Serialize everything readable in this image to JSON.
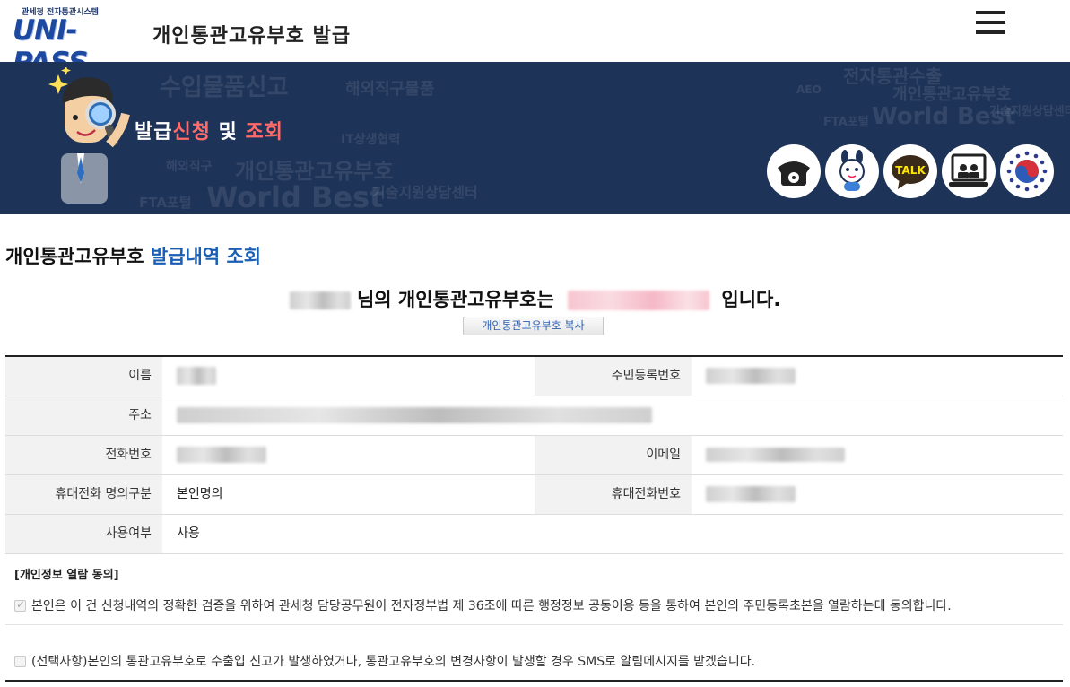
{
  "header": {
    "logo_sub": "관세청 전자통관시스템",
    "logo_main": "UNI-PASS",
    "title": "개인통관고유부호 발급"
  },
  "banner": {
    "title_part1": "발급",
    "title_part2": "신청",
    "title_part3": " 및 ",
    "title_part4": "조회",
    "background_words": [
      "수입물품신고",
      "해외직구물품",
      "전자통관수출",
      "개인통관고유부호",
      "World Best",
      "기술지원상담센터",
      "FTA포털",
      "AEO",
      "해외직구",
      "IT상생협력"
    ],
    "icons": [
      "telephone-icon",
      "mascot-chat-icon",
      "kakao-talk-icon",
      "remote-support-icon",
      "government-emblem-icon"
    ],
    "icon_talk_label": "TALK"
  },
  "section": {
    "title_black": "개인통관고유부호",
    "title_blue": "발급내역 조회"
  },
  "result": {
    "suffix_name": "님의 개인통관고유부호는",
    "suffix_end": "입니다.",
    "copy_button": "개인통관고유부호 복사"
  },
  "table": {
    "name_label": "이름",
    "rrn_label": "주민등록번호",
    "address_label": "주소",
    "phone_label": "전화번호",
    "email_label": "이메일",
    "mobile_owner_label": "휴대전화 명의구분",
    "mobile_owner_value": "본인명의",
    "mobile_label": "휴대전화번호",
    "usage_label": "사용여부",
    "usage_value": "사용"
  },
  "consent": {
    "title": "[개인정보 열람 동의]",
    "item1": "본인은 이 건 신청내역의 정확한 검증을 위하여 관세청 담당공무원이 전자정부법 제 36조에 따른 행정정보 공동이용 등을 통하여 본인의 주민등록초본을 열람하는데 동의합니다.",
    "item1_checked": true,
    "item2": "(선택사항)본인의 통관고유부호로 수출입 신고가 발생하였거나, 통관고유부호의 변경사항이 발생할 경우 SMS로 알림메시지를 받겠습니다.",
    "item2_checked": false
  },
  "colors": {
    "banner_bg": "#1e3358",
    "accent_red": "#ff6b6b",
    "accent_blue": "#1a5fb4",
    "label_bg": "#f2f2f2"
  }
}
